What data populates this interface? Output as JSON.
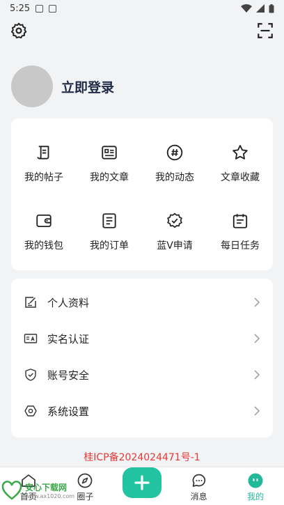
{
  "status_bar": {
    "time": "5:25"
  },
  "topbar": {
    "settings_icon": "gear-icon",
    "scan_icon": "scan-icon"
  },
  "profile": {
    "login_label": "立即登录"
  },
  "grid": {
    "items": [
      {
        "label": "我的帖子",
        "icon": "post-icon"
      },
      {
        "label": "我的文章",
        "icon": "article-icon"
      },
      {
        "label": "我的动态",
        "icon": "hashtag-icon"
      },
      {
        "label": "文章收藏",
        "icon": "star-icon"
      },
      {
        "label": "我的钱包",
        "icon": "wallet-icon"
      },
      {
        "label": "我的订单",
        "icon": "order-icon"
      },
      {
        "label": "蓝V申请",
        "icon": "badge-icon"
      },
      {
        "label": "每日任务",
        "icon": "calendar-icon"
      }
    ]
  },
  "list": {
    "items": [
      {
        "label": "个人资料",
        "icon": "edit-profile-icon"
      },
      {
        "label": "实名认证",
        "icon": "id-card-icon"
      },
      {
        "label": "账号安全",
        "icon": "shield-icon"
      },
      {
        "label": "系统设置",
        "icon": "hexagon-settings-icon"
      }
    ]
  },
  "icp": "桂ICP备2024024471号-1",
  "tabbar": {
    "tabs": [
      {
        "label": "首页",
        "icon": "home-icon"
      },
      {
        "label": "圈子",
        "icon": "compass-icon"
      },
      {
        "label": "",
        "icon": "plus-icon"
      },
      {
        "label": "消息",
        "icon": "chat-icon"
      },
      {
        "label": "我的",
        "icon": "profile-face-icon"
      }
    ],
    "active_color": "#22b89a"
  },
  "watermark": {
    "title": "安心下载网",
    "url": "www.ax1020.com"
  }
}
